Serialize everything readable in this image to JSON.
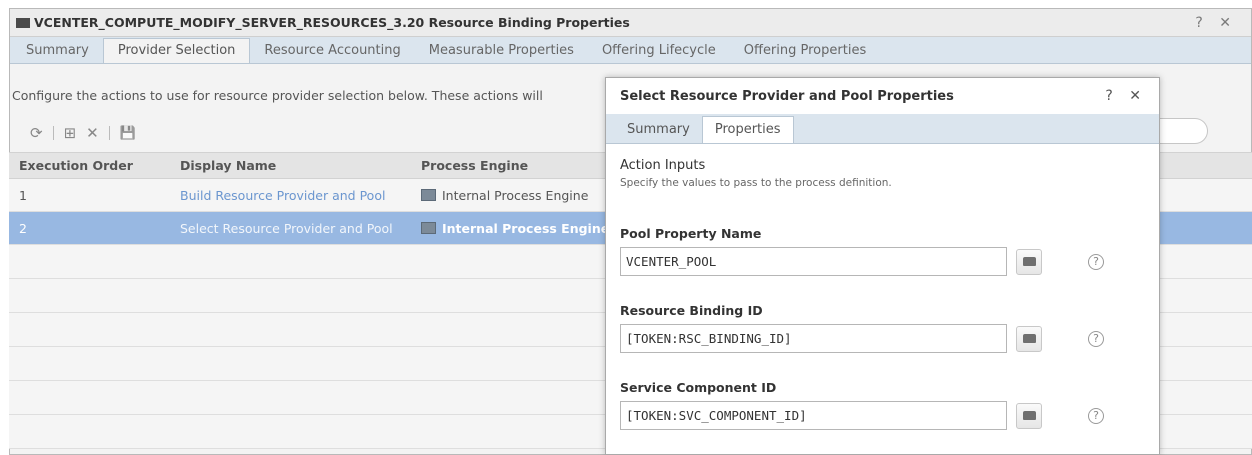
{
  "window": {
    "title": "VCENTER_COMPUTE_MODIFY_SERVER_RESOURCES_3.20 Resource Binding Properties",
    "controls": "? ✕"
  },
  "tabs": [
    "Summary",
    "Provider Selection",
    "Resource Accounting",
    "Measurable Properties",
    "Offering Lifecycle",
    "Offering Properties"
  ],
  "active_tab": "Provider Selection",
  "description": "Configure the actions to use for resource provider selection below. These actions will",
  "toolbar": {
    "refresh_icon": "⟳",
    "add_icon": "⊞",
    "delete_icon": "✕",
    "save_icon": "💾"
  },
  "grid": {
    "headers": [
      "Execution Order",
      "Display Name",
      "Process Engine"
    ],
    "rows": [
      {
        "order": "1",
        "name": "Build Resource Provider and Pool",
        "engine": "Internal Process Engine",
        "selected": false
      },
      {
        "order": "2",
        "name": "Select Resource Provider and Pool",
        "engine": "Internal Process Engine",
        "selected": true
      }
    ]
  },
  "dialog": {
    "title": "Select Resource Provider and Pool Properties",
    "controls": "? ✕",
    "tabs": [
      "Summary",
      "Properties"
    ],
    "active_tab": "Properties",
    "section_title": "Action Inputs",
    "section_sub": "Specify the values to pass to the process definition.",
    "fields": [
      {
        "label": "Pool Property Name",
        "value": "VCENTER_POOL"
      },
      {
        "label": "Resource Binding ID",
        "value": "[TOKEN:RSC_BINDING_ID]"
      },
      {
        "label": "Service Component ID",
        "value": "[TOKEN:SVC_COMPONENT_ID]"
      }
    ],
    "help_glyph": "?"
  },
  "colors": {
    "selection": "#98b8e2",
    "link": "#6b96cf",
    "tabbar": "#dbe5ee"
  }
}
